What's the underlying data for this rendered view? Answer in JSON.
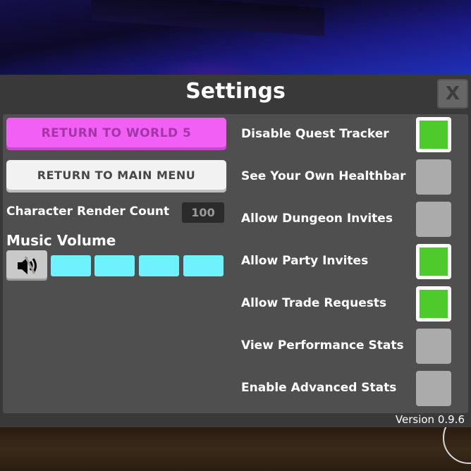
{
  "window": {
    "title": "Settings",
    "close_label": "X",
    "version": "Version 0.9.6"
  },
  "left": {
    "return_world_label": "RETURN TO WORLD 5",
    "return_menu_label": "RETURN TO MAIN MENU",
    "render_count_label": "Character Render Count",
    "render_count_value": "100",
    "music_volume_label": "Music Volume",
    "music_volume_level": "4/4",
    "speaker_icon": "speaker-muted-icon"
  },
  "options": [
    {
      "label": "Disable Quest Tracker",
      "checked": true
    },
    {
      "label": "See Your Own Healthbar",
      "checked": false
    },
    {
      "label": "Allow Dungeon Invites",
      "checked": false
    },
    {
      "label": "Allow Party Invites",
      "checked": true
    },
    {
      "label": "Allow Trade Requests",
      "checked": true
    },
    {
      "label": "View Performance Stats",
      "checked": false
    },
    {
      "label": "Enable Advanced Stats",
      "checked": false
    }
  ],
  "colors": {
    "accent_pink": "#f25ff5",
    "toggle_on": "#4ccb2a",
    "toggle_off": "#ababab",
    "volume_bar": "#6ef2fd"
  }
}
